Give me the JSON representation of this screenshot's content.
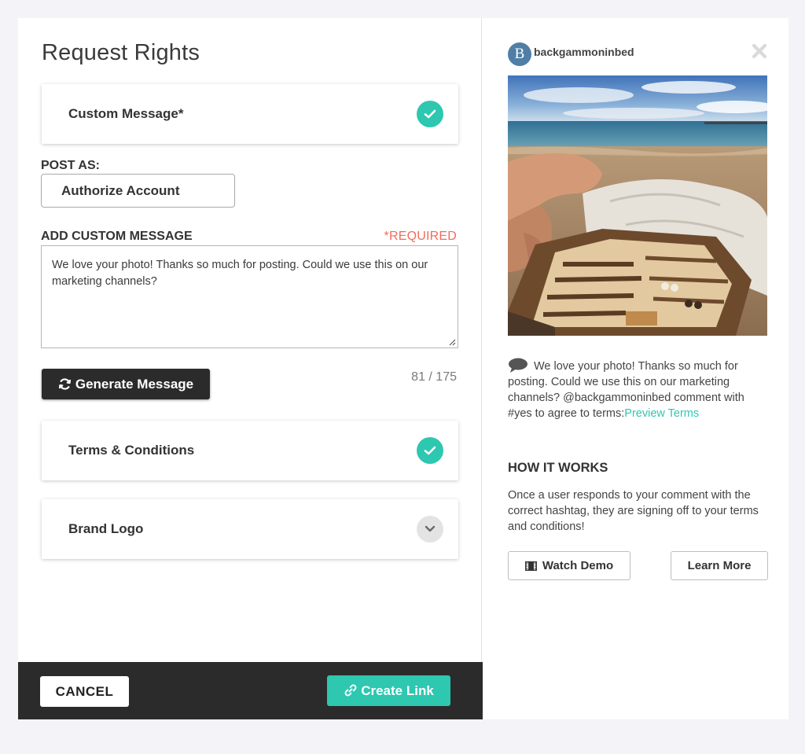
{
  "modal": {
    "title": "Request Rights"
  },
  "cards": {
    "custom_message": {
      "label": "Custom Message*",
      "status": "complete"
    },
    "terms": {
      "label": "Terms & Conditions",
      "status": "complete"
    },
    "brand_logo": {
      "label": "Brand Logo",
      "status": "collapsed"
    }
  },
  "post_as": {
    "label": "POST AS:",
    "button": "Authorize Account"
  },
  "custom_message": {
    "label": "ADD CUSTOM MESSAGE",
    "required": "*REQUIRED",
    "value": "We love your photo!  Thanks so much for posting.  Could we use this on our marketing channels?",
    "char_count": "81 / 175",
    "generate_button": "Generate Message"
  },
  "footer": {
    "cancel": "CANCEL",
    "create": "Create Link"
  },
  "preview": {
    "avatar_letter": "B",
    "username": "backgammoninbed",
    "comment_text": "We love your photo! Thanks so much for posting. Could we use this on our marketing channels? @backgammoninbed comment with #yes to agree to terms:",
    "preview_link": "Preview Terms"
  },
  "how_it_works": {
    "title": "HOW IT WORKS",
    "text": "Once a user responds to your comment with the correct hashtag, they are signing off to your terms and conditions!",
    "demo_button": "Watch Demo",
    "learn_button": "Learn More"
  },
  "colors": {
    "accent": "#2ec7b0",
    "required": "#f26b5b",
    "footer": "#2b2b2b",
    "avatar": "#4f7ea6"
  },
  "icons": [
    "check-icon",
    "chevron-down-icon",
    "refresh-icon",
    "link-icon",
    "close-icon",
    "comment-icon",
    "film-icon"
  ]
}
